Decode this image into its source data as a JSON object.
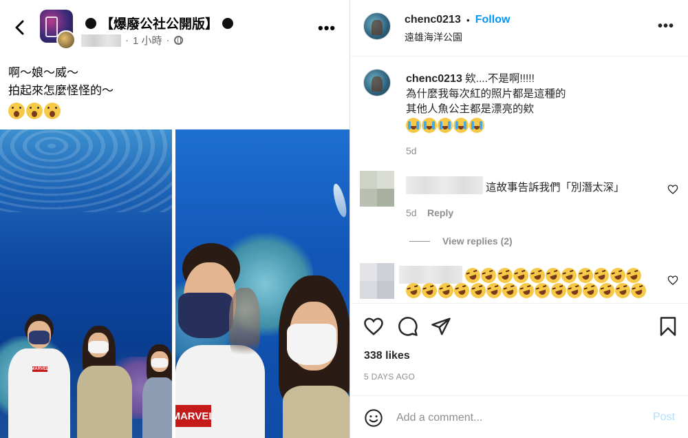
{
  "facebook": {
    "group_name": "【爆廢公社公開版】",
    "time": "1 小時",
    "post_lines": [
      "啊～娘～威～",
      "拍起來怎麼怪怪的～"
    ],
    "emoji": "scream-face",
    "shirt_logo": "MARVEL"
  },
  "instagram": {
    "header": {
      "username": "chenc0213",
      "separator": "•",
      "follow": "Follow",
      "location": "遠雄海洋公園"
    },
    "caption": {
      "username": "chenc0213",
      "line1": "欸....不是啊!!!!!",
      "line2": "為什麼我每次紅的照片都是這種的",
      "line3": "其他人魚公主都是漂亮的欸",
      "emoji": "loudly-crying-face",
      "time": "5d"
    },
    "comments": [
      {
        "text": "這故事告訴我們「別潛太深」",
        "time": "5d",
        "reply": "Reply"
      },
      {
        "emoji": "rolling-on-the-floor-laughing"
      }
    ],
    "view_replies": "View replies (2)",
    "likes": "338 likes",
    "posted": "5 DAYS AGO",
    "add_comment_placeholder": "Add a comment...",
    "post": "Post"
  }
}
